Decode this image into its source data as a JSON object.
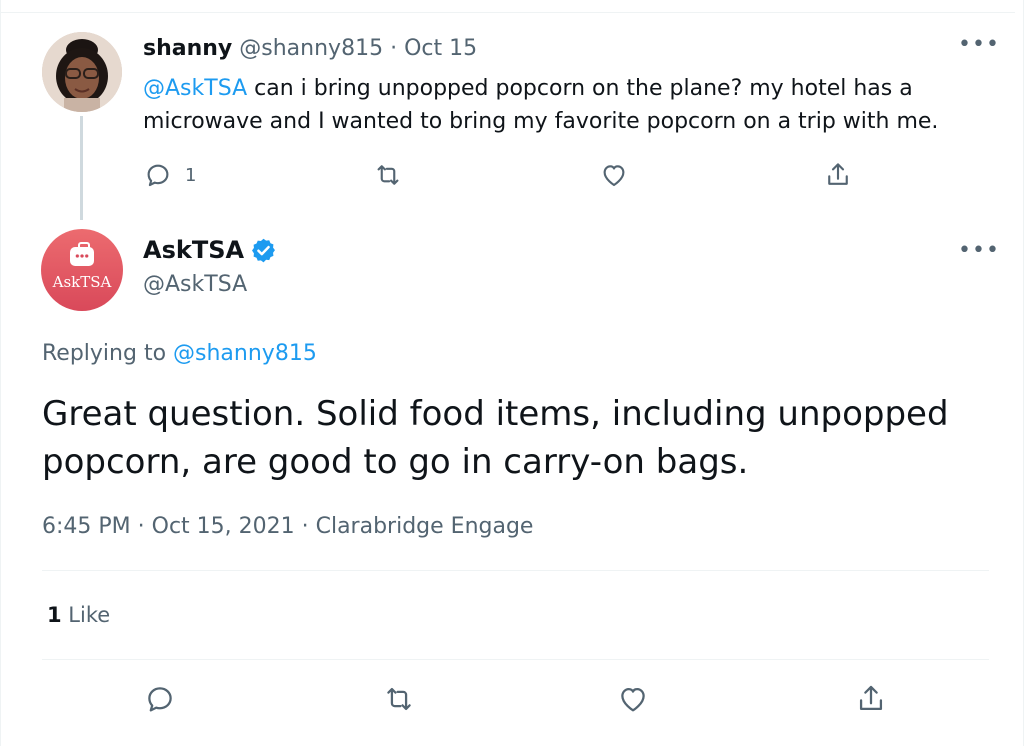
{
  "parent": {
    "name": "shanny",
    "handle": "@shanny815",
    "sep": " · ",
    "date": "Oct 15",
    "mention": "@AskTSA",
    "text": " can i bring unpopped popcorn on the plane? my hotel has a microwave and I wanted to bring my favorite popcorn on a trip with me.",
    "reply_count": "1",
    "more": "•••"
  },
  "reply": {
    "name": "AskTSA",
    "handle": "@AskTSA",
    "avatar_text": "AskTSA",
    "replying_prefix": "Replying to ",
    "replying_handle": "@shanny815",
    "text": "Great question. Solid food items, including unpopped popcorn, are good to go in carry-on bags.",
    "timestamp": "6:45 PM · Oct 15, 2021 · Clarabridge Engage",
    "like_count": "1",
    "like_label": " Like",
    "more": "•••"
  },
  "colors": {
    "accent": "#1d9bf0",
    "secondary_text": "#536471",
    "avatar_tsa": "#d9495a"
  },
  "icons": {
    "reply": "reply-icon",
    "retweet": "retweet-icon",
    "like": "heart-icon",
    "share": "share-icon",
    "verified": "verified-badge-icon",
    "more": "more-icon"
  }
}
